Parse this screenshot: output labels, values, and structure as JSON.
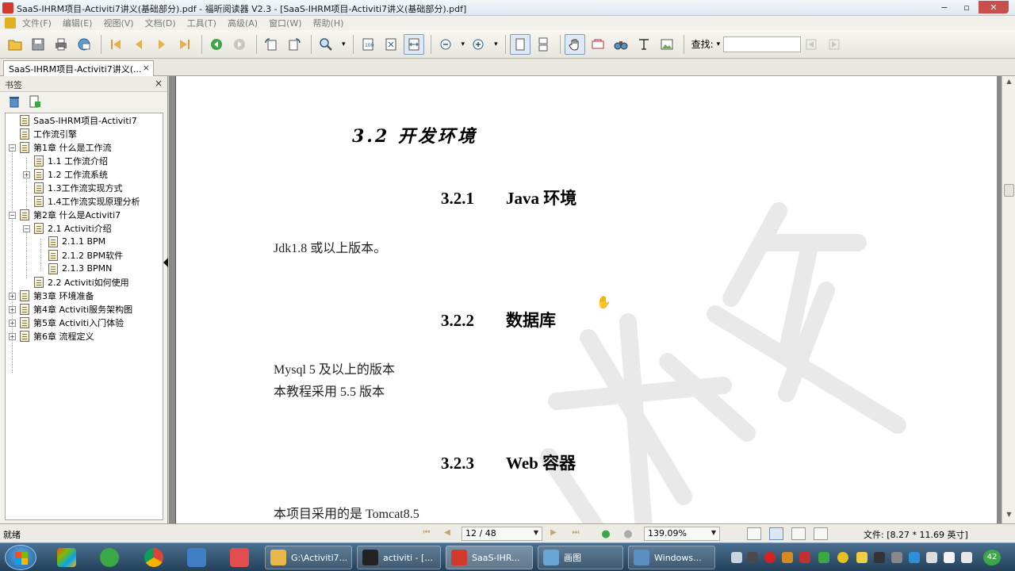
{
  "window": {
    "title": "SaaS-IHRM项目-Activiti7讲义(基础部分).pdf - 福昕阅读器 V2.3 - [SaaS-IHRM项目-Activiti7讲义(基础部分).pdf]",
    "minimize": "−",
    "restore": "▫",
    "close": "✕"
  },
  "menu": [
    "文件(F)",
    "编辑(E)",
    "视图(V)",
    "文档(D)",
    "工具(T)",
    "高级(A)",
    "窗口(W)",
    "帮助(H)"
  ],
  "toolbar": {
    "search_label": "查找:",
    "search_dropdown": "▾",
    "search_value": ""
  },
  "tab": {
    "label": "SaaS-IHRM项目-Activiti7讲义(...",
    "close": "×"
  },
  "bookmarks": {
    "header": "书签",
    "close": "×",
    "items": [
      {
        "label": "SaaS-IHRM项目-Activiti7",
        "level": 0,
        "expander": ""
      },
      {
        "label": "工作流引擎",
        "level": 0,
        "expander": ""
      },
      {
        "label": "第1章 什么是工作流",
        "level": 0,
        "expander": "−"
      },
      {
        "label": "1.1 工作流介绍",
        "level": 1,
        "expander": ""
      },
      {
        "label": "1.2 工作流系统",
        "level": 1,
        "expander": "+"
      },
      {
        "label": "1.3工作流实现方式",
        "level": 1,
        "expander": ""
      },
      {
        "label": "1.4工作流实现原理分析",
        "level": 1,
        "expander": ""
      },
      {
        "label": "第2章 什么是Activiti7",
        "level": 0,
        "expander": "−"
      },
      {
        "label": "2.1 Activiti介绍",
        "level": 1,
        "expander": "−"
      },
      {
        "label": "2.1.1 BPM",
        "level": 2,
        "expander": ""
      },
      {
        "label": "2.1.2 BPM软件",
        "level": 2,
        "expander": ""
      },
      {
        "label": "2.1.3 BPMN",
        "level": 2,
        "expander": ""
      },
      {
        "label": "2.2 Activiti如何使用",
        "level": 1,
        "expander": ""
      },
      {
        "label": "第3章 环境准备",
        "level": 0,
        "expander": "+"
      },
      {
        "label": "第4章 Activiti服务架构图",
        "level": 0,
        "expander": "+"
      },
      {
        "label": "第5章 Activiti入门体验",
        "level": 0,
        "expander": "+"
      },
      {
        "label": "第6章 流程定义",
        "level": 0,
        "expander": "+"
      }
    ]
  },
  "document": {
    "section_title": "3.2 开发环境",
    "sub1_num": "3.2.1",
    "sub1_title": "Java 环境",
    "sub1_text": "Jdk1.8 或以上版本。",
    "sub2_num": "3.2.2",
    "sub2_title": "数据库",
    "sub2_text1": "Mysql 5 及以上的版本",
    "sub2_text2": "本教程采用 5.5 版本",
    "sub3_num": "3.2.3",
    "sub3_title": "Web 容器",
    "sub3_text": "本项目采用的是 Tomcat8.5"
  },
  "status": {
    "ready": "就绪",
    "page": "12 / 48",
    "zoom": "139.09%",
    "size": "文件: [8.27 * 11.69 英寸]"
  },
  "taskbar": {
    "items": [
      {
        "label": "G:\\Activiti7...",
        "color": "#e8b84a"
      },
      {
        "label": "activiti - [...",
        "color": "#222222"
      },
      {
        "label": "SaaS-IHR...",
        "color": "#d23b2c"
      },
      {
        "label": "画图",
        "color": "#6aa5d8"
      },
      {
        "label": "Windows...",
        "color": "#5b8fc4"
      }
    ],
    "badge": "42"
  },
  "colors": {
    "accent": "#316ac5",
    "taskbar": "#24405a"
  }
}
